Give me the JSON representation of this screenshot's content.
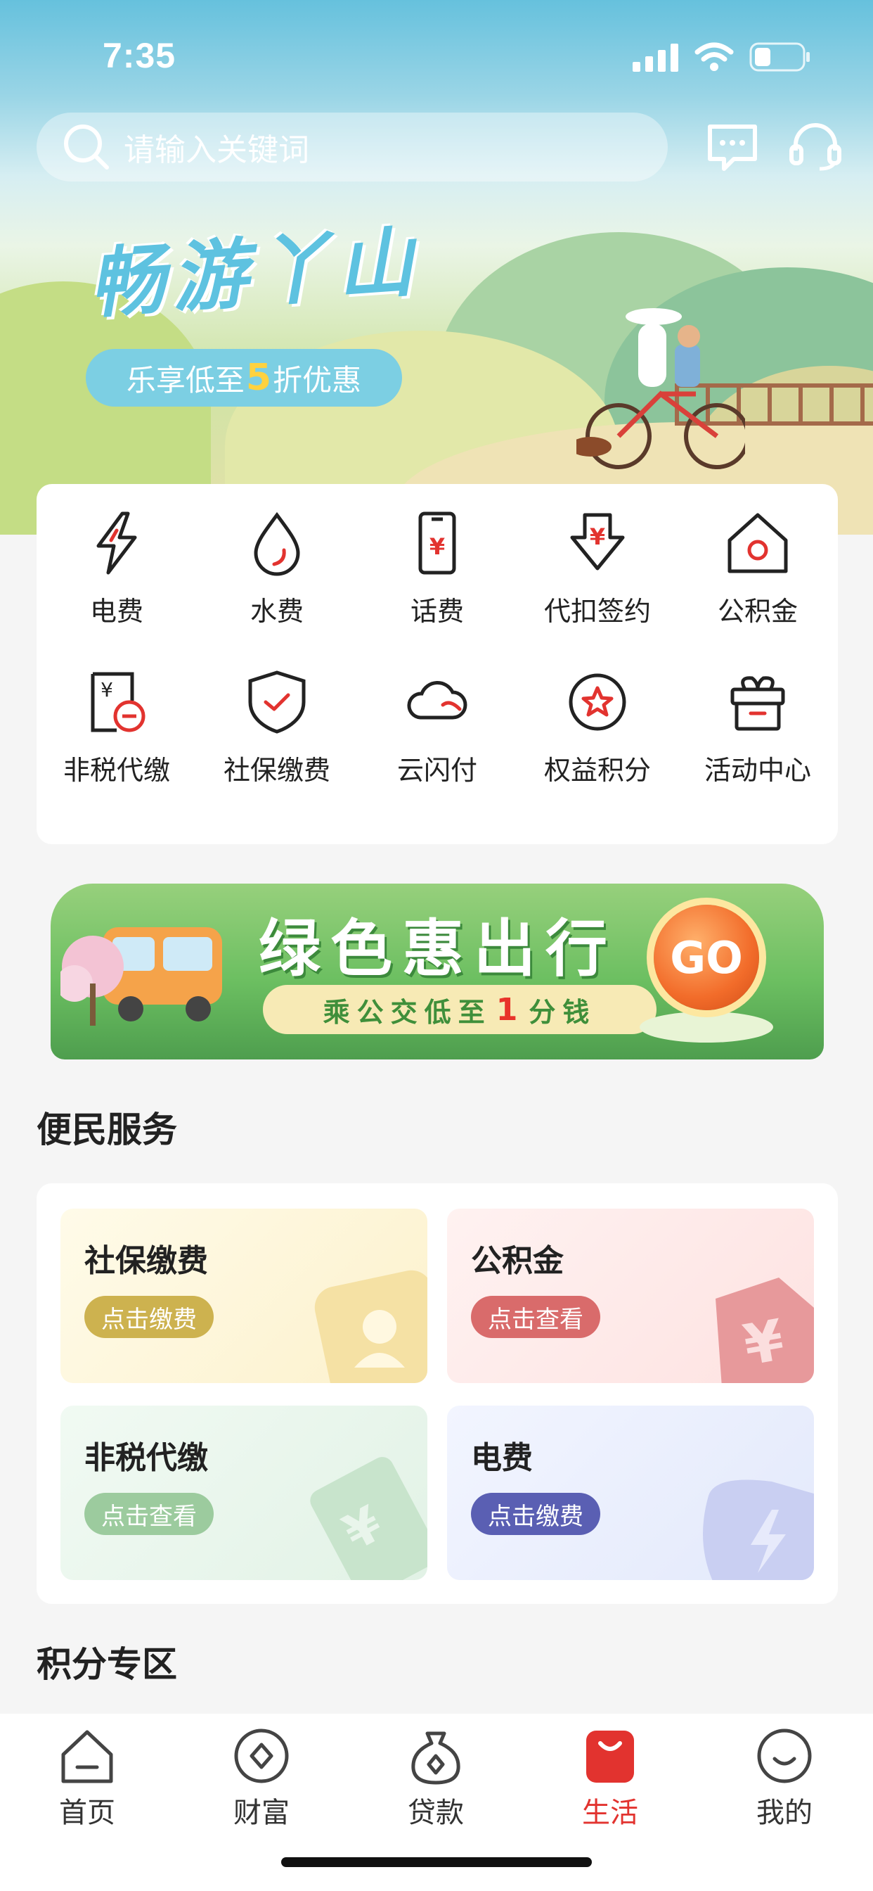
{
  "status_bar": {
    "time": "7:35"
  },
  "search": {
    "placeholder": "请输入关键词"
  },
  "hero": {
    "title": "畅游丫山",
    "pill_before": "乐享低至",
    "pill_accent": "5",
    "pill_after": "折优惠"
  },
  "services_grid": [
    {
      "label": "电费",
      "icon": "lightning-icon"
    },
    {
      "label": "水费",
      "icon": "water-drop-icon"
    },
    {
      "label": "话费",
      "icon": "phone-yen-icon"
    },
    {
      "label": "代扣签约",
      "icon": "arrow-yen-icon"
    },
    {
      "label": "公积金",
      "icon": "house-icon"
    },
    {
      "label": "非税代缴",
      "icon": "tax-doc-icon"
    },
    {
      "label": "社保缴费",
      "icon": "shield-check-icon"
    },
    {
      "label": "云闪付",
      "icon": "cloud-pay-icon"
    },
    {
      "label": "权益积分",
      "icon": "star-badge-icon"
    },
    {
      "label": "活动中心",
      "icon": "gift-box-icon"
    }
  ],
  "promo": {
    "title": "绿色惠出行",
    "pill_before": "乘公交低至",
    "pill_num": "1",
    "pill_after": "分钱",
    "go": "GO"
  },
  "section_convenience": {
    "title": "便民服务"
  },
  "convenience_tiles": [
    {
      "title": "社保缴费",
      "button": "点击缴费",
      "color": "#cdb24f"
    },
    {
      "title": "公积金",
      "button": "点击查看",
      "color": "#d96b6b"
    },
    {
      "title": "非税代缴",
      "button": "点击查看",
      "color": "#9ccb9e"
    },
    {
      "title": "电费",
      "button": "点击缴费",
      "color": "#5a5fb3"
    }
  ],
  "section_points": {
    "title": "积分专区"
  },
  "tabbar": [
    {
      "label": "首页",
      "icon": "home-icon"
    },
    {
      "label": "财富",
      "icon": "wealth-icon"
    },
    {
      "label": "贷款",
      "icon": "loan-bag-icon"
    },
    {
      "label": "生活",
      "icon": "shopping-bag-icon",
      "active": true
    },
    {
      "label": "我的",
      "icon": "profile-smile-icon"
    }
  ],
  "accent_color": "#e2332f"
}
